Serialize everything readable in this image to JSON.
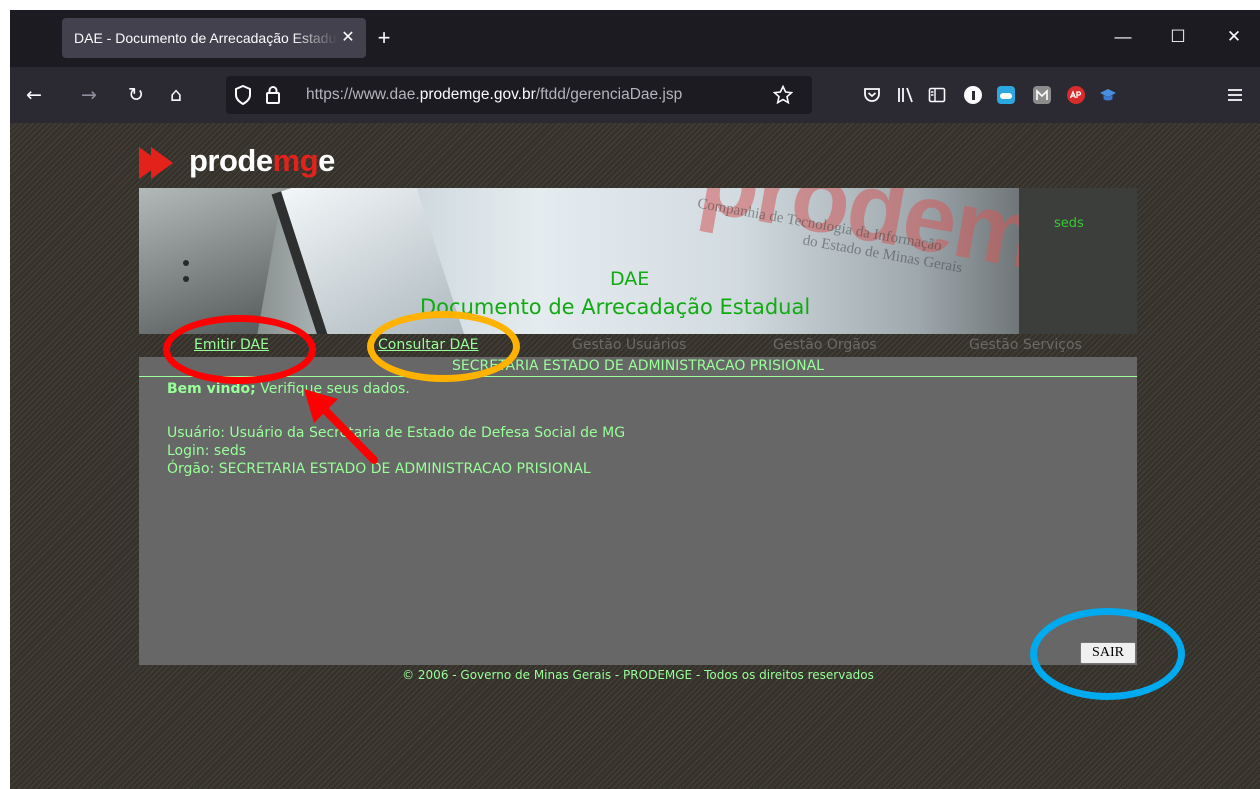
{
  "browser": {
    "tab_title": "DAE - Documento de Arrecadação Estadual",
    "tab_close": "✕",
    "new_tab": "+",
    "window_controls": {
      "minimize": "—",
      "maximize": "☐",
      "close": "✕"
    },
    "nav": {
      "back": "←",
      "forward": "→",
      "reload": "↻",
      "home": "⌂"
    },
    "url": {
      "prefix": "https://www.dae.",
      "domain": "prodemge.gov.br",
      "path": "/ftdd/gerenciaDae.jsp"
    },
    "icons": [
      "shield-icon",
      "lock-icon",
      "bookmark-star-icon",
      "pocket-icon",
      "library-icon",
      "sidebar-icon",
      "extension-icons",
      "menu-icon"
    ]
  },
  "page": {
    "logo": {
      "part1": "prode",
      "part2": "mg",
      "part3": "e"
    },
    "banner": {
      "user": "seds",
      "dae": "DAE",
      "title": "Documento de Arrecadação Estadual",
      "watermark": "prodemg",
      "watermark_sub_1": "Companhia de Tecnologia da Informação",
      "watermark_sub_2": "do Estado de Minas Gerais"
    },
    "menu": [
      {
        "label": "Emitir DAE",
        "active": true
      },
      {
        "label": "Consultar DAE",
        "active": true
      },
      {
        "label": "Gestão Usuários",
        "active": false
      },
      {
        "label": "Gestão Orgãos",
        "active": false
      },
      {
        "label": "Gestão Serviços",
        "active": false
      }
    ],
    "secretaria": "SECRETARIA ESTADO DE ADMINISTRACAO PRISIONAL",
    "welcome_bold": "Bem vindo;",
    "welcome_rest": " Verifique seus dados.",
    "info": {
      "usuario": "Usuário: Usuário da Secretaria de Estado de Defesa Social de MG",
      "login": "Login: seds",
      "orgao": "Órgão: SECRETARIA ESTADO DE ADMINISTRACAO PRISIONAL"
    },
    "sair_button": "SAIR",
    "footer": "© 2006 - Governo de Minas Gerais - PRODEMGE - Todos os direitos reservados"
  },
  "colors": {
    "page_text": "#99ff99",
    "banner_text": "#11aa11",
    "annotation_red": "#ff0000",
    "annotation_yellow": "#ffb300",
    "annotation_blue": "#00aaee"
  }
}
